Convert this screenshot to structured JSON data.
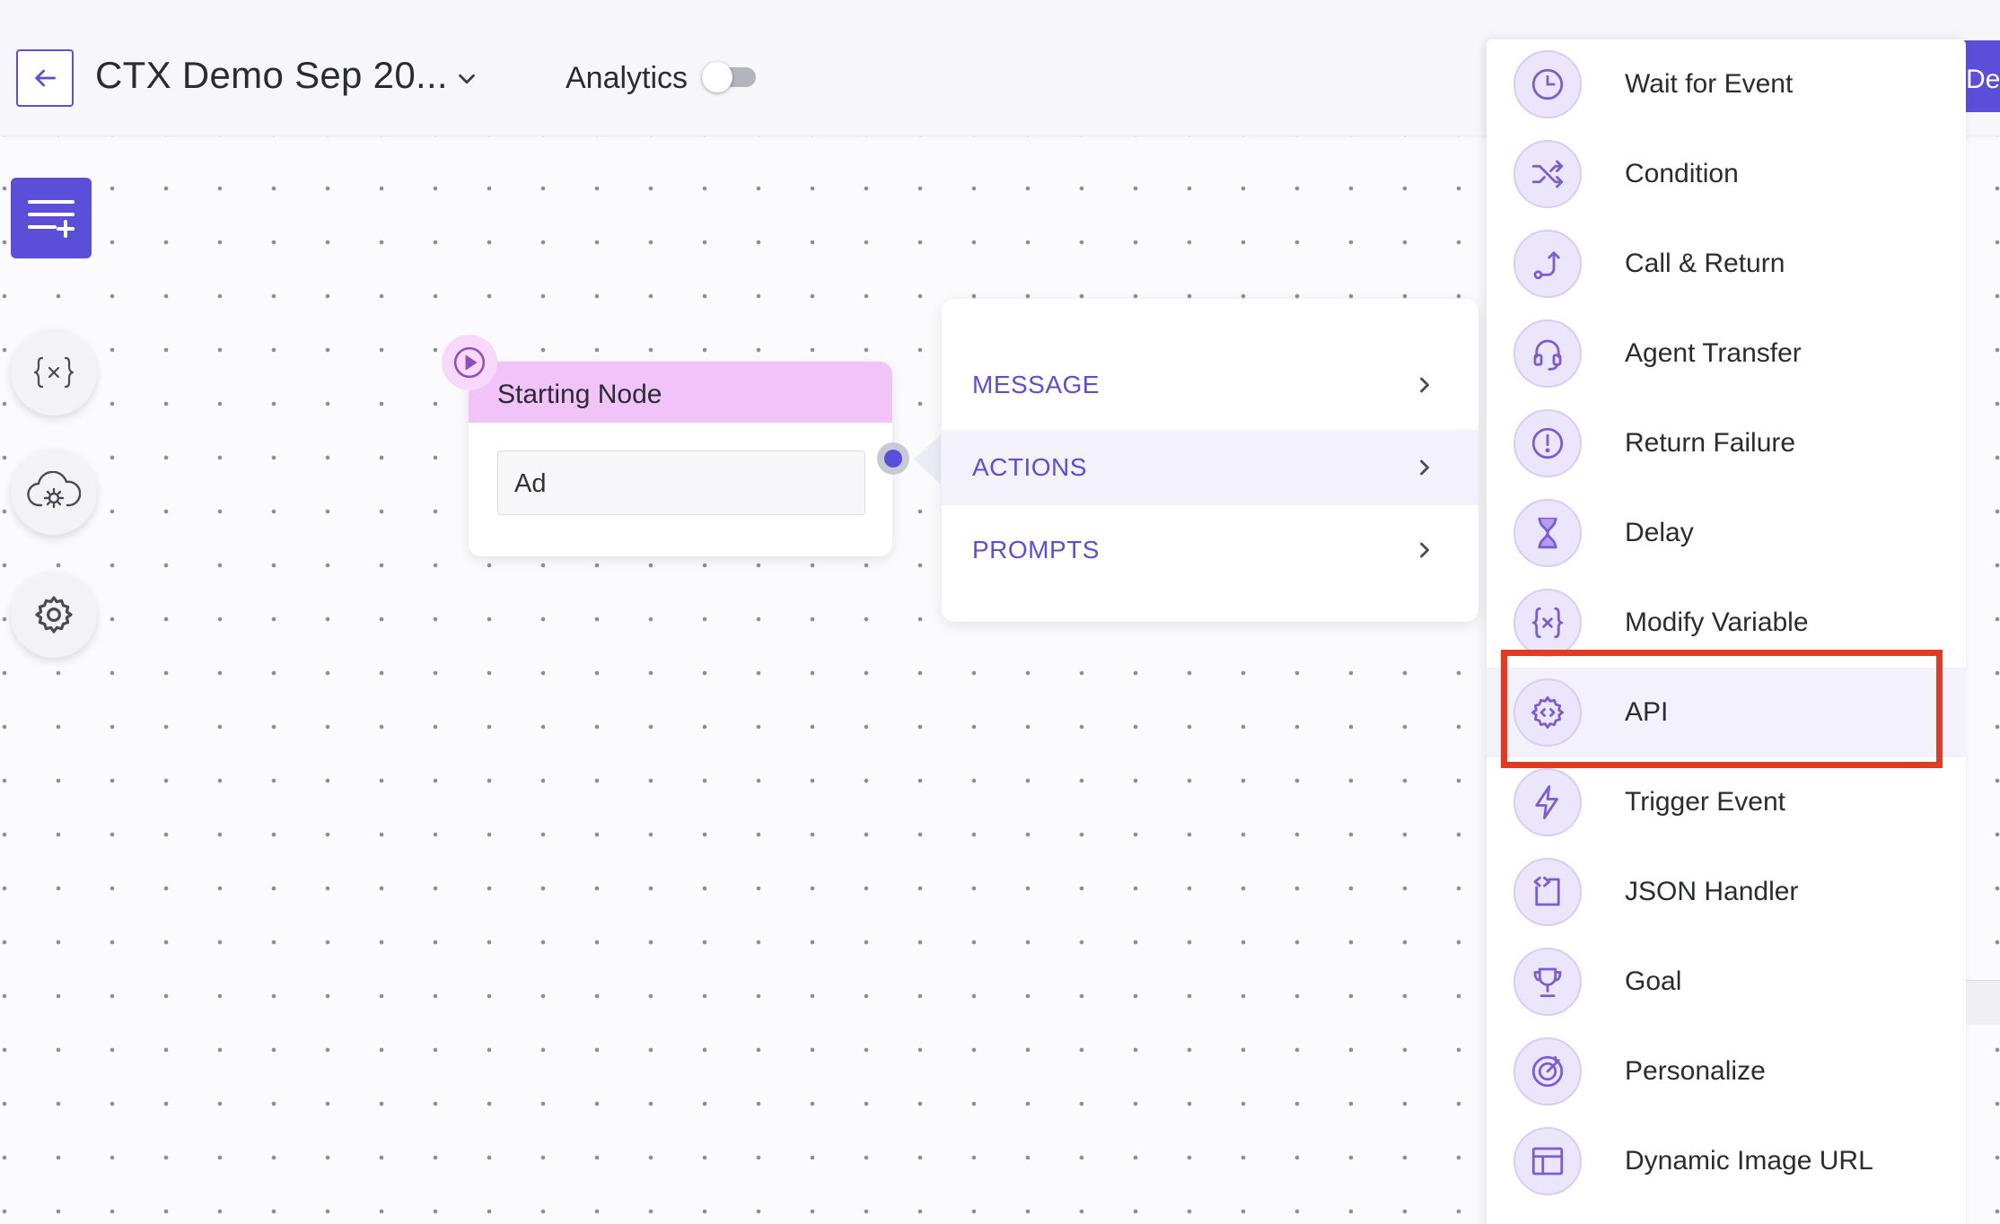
{
  "header": {
    "title": "CTX Demo Sep 20...",
    "analytics_label": "Analytics",
    "deploy_label": "Deploy",
    "analytics_enabled": false
  },
  "node": {
    "title": "Starting Node",
    "input_value": "Ad"
  },
  "menu": {
    "items": [
      {
        "label": "MESSAGE",
        "active": false
      },
      {
        "label": "ACTIONS",
        "active": true
      },
      {
        "label": "PROMPTS",
        "active": false
      }
    ]
  },
  "submenu": {
    "items": [
      {
        "label": "Wait for Event",
        "icon": "clock-icon"
      },
      {
        "label": "Condition",
        "icon": "shuffle-icon"
      },
      {
        "label": "Call & Return",
        "icon": "route-icon"
      },
      {
        "label": "Agent Transfer",
        "icon": "headset-icon"
      },
      {
        "label": "Return Failure",
        "icon": "alert-circle-icon"
      },
      {
        "label": "Delay",
        "icon": "hourglass-icon"
      },
      {
        "label": "Modify Variable",
        "icon": "variable-icon"
      },
      {
        "label": "API",
        "icon": "api-gear-icon",
        "highlighted": true
      },
      {
        "label": "Trigger Event",
        "icon": "lightning-icon"
      },
      {
        "label": "JSON Handler",
        "icon": "code-file-icon"
      },
      {
        "label": "Goal",
        "icon": "trophy-icon"
      },
      {
        "label": "Personalize",
        "icon": "target-icon"
      },
      {
        "label": "Dynamic Image URL",
        "icon": "layout-icon"
      }
    ]
  },
  "colors": {
    "accent": "#5b4ed8",
    "node_header": "#f1c3f8",
    "highlight_border": "#e23a23",
    "icon_bg": "#ebe6fb"
  }
}
